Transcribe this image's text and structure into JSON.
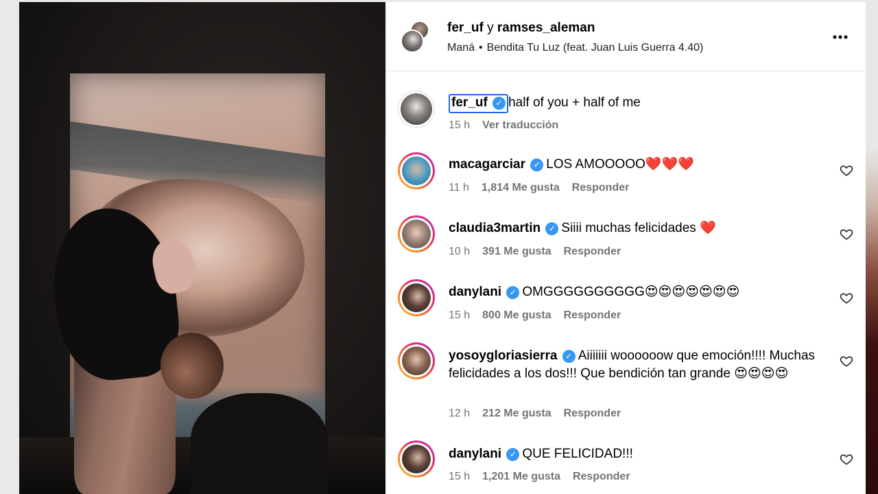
{
  "header": {
    "user1": "fer_uf",
    "joiner": "y",
    "user2": "ramses_aleman",
    "artist": "Maná",
    "separator": "•",
    "song": "Bendita Tu Luz (feat. Juan Luis Guerra 4.40)",
    "more_icon": "more-horizontal-icon"
  },
  "caption": {
    "username": "fer_uf",
    "verified_icon": "verified-badge-icon",
    "text": "half of you + half of me",
    "time": "15 h",
    "translate": "Ver traducción"
  },
  "comments": [
    {
      "username": "macagarciar",
      "text": "LOS AMOOOOO❤️❤️❤️",
      "time": "11 h",
      "likes": "1,814 Me gusta",
      "reply": "Responder"
    },
    {
      "username": "claudia3martin",
      "text": "Siiii muchas felicidades ❤️",
      "time": "10 h",
      "likes": "391 Me gusta",
      "reply": "Responder"
    },
    {
      "username": "danylani",
      "text": "OMGGGGGGGGGG😍😍😍😍😍😍😍",
      "time": "15 h",
      "likes": "800 Me gusta",
      "reply": "Responder"
    },
    {
      "username": "yosoygloriasierra",
      "text": "Aiiiiiii woooooow que emoción!!!! Muchas felicidades a los dos!!! Que bendición tan grande 😍😍😍😍",
      "time": "12 h",
      "likes": "212 Me gusta",
      "reply": "Responder"
    },
    {
      "username": "danylani",
      "text": "QUE FELICIDAD!!!",
      "time": "15 h",
      "likes": "1,201 Me gusta",
      "reply": "Responder"
    }
  ],
  "icons": {
    "like": "heart-outline-icon"
  },
  "colors": {
    "verified": "#3897f0",
    "meta_text": "#737373",
    "highlight_border": "#2563eb"
  }
}
